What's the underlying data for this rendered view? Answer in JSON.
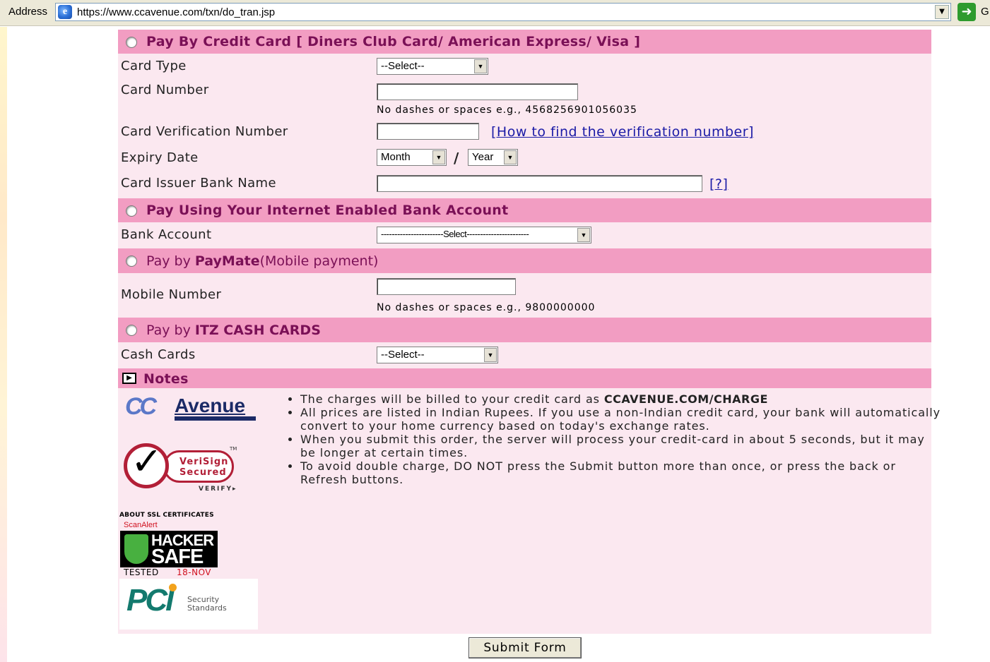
{
  "browser": {
    "address_label": "Address",
    "url": "https://www.ccavenue.com/txn/do_tran.jsp",
    "go_label": "G"
  },
  "credit_card": {
    "header": "Pay By Credit Card [ Diners Club Card/ American Express/ Visa ]",
    "card_type_label": "Card Type",
    "card_type_value": "--Select--",
    "card_number_label": "Card Number",
    "card_number_hint": "No dashes or spaces e.g., 4568256901056035",
    "cvv_label": "Card Verification Number",
    "cvv_link": "[How to find the verification number]",
    "expiry_label": "Expiry Date",
    "expiry_month": "Month",
    "expiry_separator": "/",
    "expiry_year": "Year",
    "issuer_label": "Card Issuer Bank Name",
    "issuer_help": "[?]"
  },
  "netbanking": {
    "header": "Pay Using Your Internet Enabled Bank Account",
    "bank_label": "Bank Account",
    "bank_value": "-----------------------Select-----------------------"
  },
  "paymate": {
    "header_prefix": "Pay by ",
    "header_brand": "PayMate",
    "header_suffix": "(Mobile payment)",
    "mobile_label": "Mobile Number",
    "mobile_hint": "No dashes or spaces e.g., 9800000000"
  },
  "itz": {
    "header_prefix": "Pay by ",
    "header_brand": "ITZ CASH CARDS",
    "cash_label": "Cash Cards",
    "cash_value": "--Select--"
  },
  "notes": {
    "header": "Notes",
    "items": [
      {
        "text": "The charges will be billed to your credit card as ",
        "bold": "CCAVENUE.COM/CHARGE"
      },
      {
        "text": "All prices are listed in Indian Rupees. If you use a non-Indian credit card, your bank will automatically convert to your home currency based on today's exchange rates."
      },
      {
        "text": "When you submit this order, the server will process your credit-card in about 5 seconds, but it may be longer at certain times."
      },
      {
        "text": "To avoid double charge, DO NOT press the Submit button more than once, or press the back or Refresh buttons."
      }
    ]
  },
  "logos": {
    "ccavenue_cc": "CC",
    "ccavenue_name": "Avenue",
    "verisign_line1": "VeriSign",
    "verisign_line2": "Secured",
    "verisign_verify": "VERIFY▸",
    "verisign_tm": "TM",
    "ssl_label": "ABOUT SSL CERTIFICATES",
    "scanalert": "ScanAlert",
    "hacker_line1": "HACKER",
    "hacker_line2": "SAFE",
    "tested": "TESTED",
    "tested_date": "18-NOV",
    "pci_text": "PCI",
    "pci_sub1": "Security",
    "pci_sub2": "Standards"
  },
  "submit_label": "Submit Form"
}
